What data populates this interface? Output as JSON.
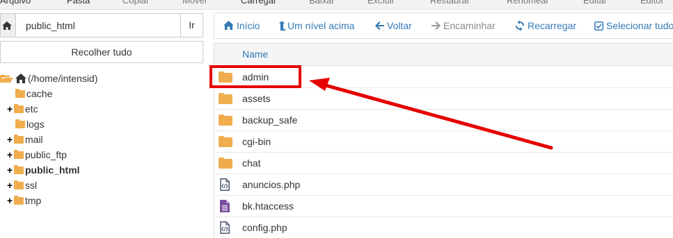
{
  "top_toolbar": {
    "items": [
      "Arquivo",
      "Pasta",
      "Copiar",
      "Mover",
      "Carregar",
      "Baixar",
      "Excluir",
      "Restaurar",
      "Renomear",
      "Editar",
      "Editor"
    ]
  },
  "left_panel": {
    "path_value": "public_html",
    "go_label": "Ir",
    "collapse_label": "Recolher tudo",
    "tree": {
      "root_label": "(/home/intensid)",
      "items": [
        {
          "label": "cache",
          "expandable": false
        },
        {
          "label": "etc",
          "expandable": true
        },
        {
          "label": "logs",
          "expandable": false
        },
        {
          "label": "mail",
          "expandable": true
        },
        {
          "label": "public_ftp",
          "expandable": true
        },
        {
          "label": "public_html",
          "expandable": true,
          "active": true
        },
        {
          "label": "ssl",
          "expandable": true
        },
        {
          "label": "tmp",
          "expandable": true
        }
      ],
      "plus_symbol": "+"
    }
  },
  "toolbar": {
    "home": "Início",
    "up_level": "Um nível acima",
    "back": "Voltar",
    "forward": "Encaminhar",
    "reload": "Recarregar",
    "select_all": "Selecionar tudo"
  },
  "file_list": {
    "column_name": "Name",
    "rows": [
      {
        "name": "admin",
        "type": "folder"
      },
      {
        "name": "assets",
        "type": "folder"
      },
      {
        "name": "backup_safe",
        "type": "folder"
      },
      {
        "name": "cgi-bin",
        "type": "folder"
      },
      {
        "name": "chat",
        "type": "folder"
      },
      {
        "name": "anuncios.php",
        "type": "code"
      },
      {
        "name": "bk.htaccess",
        "type": "text"
      },
      {
        "name": "config.php",
        "type": "code"
      }
    ]
  },
  "colors": {
    "accent": "#337ab7",
    "folder": "#f0ad4e",
    "annotation": "#e60000",
    "text_file": "#7a4d9e"
  },
  "icons": {
    "home": "home-icon",
    "up": "level-up-icon",
    "back": "arrow-left-icon",
    "forward": "arrow-right-icon",
    "reload": "refresh-icon",
    "select": "check-square-icon"
  }
}
